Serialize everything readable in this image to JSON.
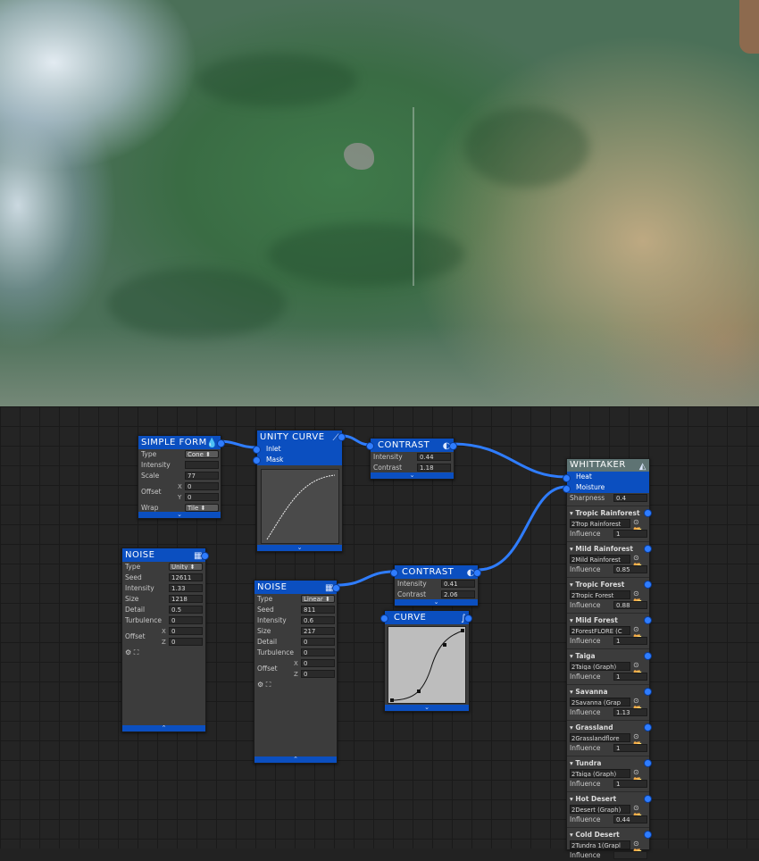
{
  "nodes": {
    "simple_form": {
      "title": "SIMPLE FORM",
      "type_label": "Type",
      "type_value": "Cone",
      "intensity_label": "Intensity",
      "intensity_value": "",
      "scale_label": "Scale",
      "scale_value": "77",
      "offset_label": "Offset",
      "offset_x": "0",
      "offset_y": "0",
      "wrap_label": "Wrap",
      "wrap_value": "Tile"
    },
    "unity_curve": {
      "title": "UNITY CURVE",
      "input1": "Inlet",
      "input2": "Mask"
    },
    "contrast_1": {
      "title": "CONTRAST",
      "intensity_label": "Intensity",
      "intensity_value": "0.44",
      "contrast_label": "Contrast",
      "contrast_value": "1.18"
    },
    "noise_1": {
      "title": "NOISE",
      "type_label": "Type",
      "type_value": "Unity",
      "seed_label": "Seed",
      "seed_value": "12611",
      "intensity_label": "Intensity",
      "intensity_value": "1.33",
      "size_label": "Size",
      "size_value": "1218",
      "detail_label": "Detail",
      "detail_value": "0.5",
      "turbulence_label": "Turbulence",
      "turbulence_value": "0",
      "offset_label": "Offset",
      "offset_x": "0",
      "offset_z": "0"
    },
    "noise_2": {
      "title": "NOISE",
      "type_label": "Type",
      "type_value": "Linear",
      "seed_label": "Seed",
      "seed_value": "811",
      "intensity_label": "Intensity",
      "intensity_value": "0.6",
      "size_label": "Size",
      "size_value": "217",
      "detail_label": "Detail",
      "detail_value": "0",
      "turbulence_label": "Turbulence",
      "turbulence_value": "0",
      "offset_label": "Offset",
      "offset_x": "0",
      "offset_z": "0"
    },
    "contrast_2": {
      "title": "CONTRAST",
      "intensity_label": "Intensity",
      "intensity_value": "0.41",
      "contrast_label": "Contrast",
      "contrast_value": "2.06"
    },
    "curve": {
      "title": "CURVE"
    },
    "whittaker": {
      "title": "WHITTAKER",
      "input1": "Heat",
      "input2": "Moisture",
      "sharpness_label": "Sharpness",
      "sharpness_value": "0.4",
      "influence_label": "Influence",
      "biomes": [
        {
          "name": "Tropic Rainforest",
          "graph": "2Trop Rainforest",
          "influence": "1"
        },
        {
          "name": "Mild Rainforest",
          "graph": "2Mild Rainforest",
          "influence": "0.85"
        },
        {
          "name": "Tropic Forest",
          "graph": "2Tropic Forest",
          "influence": "0.88"
        },
        {
          "name": "Mild Forest",
          "graph": "2ForestFLORE (C",
          "influence": "1"
        },
        {
          "name": "Taiga",
          "graph": "2Taiga (Graph)",
          "influence": "1"
        },
        {
          "name": "Savanna",
          "graph": "2Savanna (Grap",
          "influence": "1.13"
        },
        {
          "name": "Grassland",
          "graph": "2Grasslandflore",
          "influence": "1"
        },
        {
          "name": "Tundra",
          "graph": "2Taiga (Graph)",
          "influence": "1"
        },
        {
          "name": "Hot Desert",
          "graph": "2Desert (Graph)",
          "influence": "0.44"
        },
        {
          "name": "Cold Desert",
          "graph": "2Tundra 1(Grapl",
          "influence": ""
        }
      ]
    }
  },
  "colors": {
    "accent": "#0b4fc0",
    "port": "#2f7dff",
    "wire": "#2f7dff",
    "whittaker_header": "#5e7373"
  }
}
